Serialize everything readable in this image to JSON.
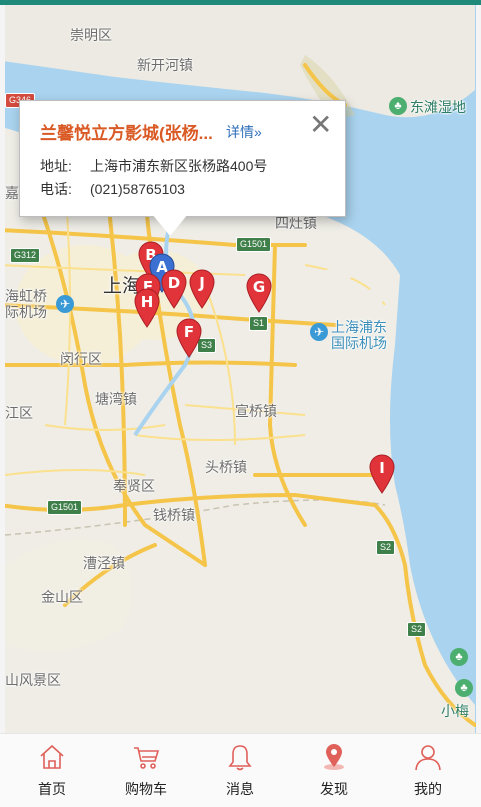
{
  "map": {
    "places": {
      "chongming": "崇明区",
      "xinhe": "新开河镇",
      "dongtan": "东滩湿地",
      "shanghai": "上海",
      "hongqiao": "海虹桥\n际机场",
      "minhang": "闵行区",
      "tangwan": "塘湾镇",
      "xuhui_left": "江区",
      "xuanqiao": "宣桥镇",
      "touqiao": "头桥镇",
      "fengxian": "奉贤区",
      "qianqiao": "钱桥镇",
      "caojing": "漕泾镇",
      "jinshan": "金山区",
      "fengjing": "山风景区",
      "pudong_airport": "上海浦东国际机场",
      "xiaomei": "小梅",
      "ding": "嘉定",
      "sixu": "四灶镇"
    },
    "road_signs": [
      "G1501",
      "G312",
      "G346",
      "G1501",
      "S1",
      "S3",
      "S2",
      "S2"
    ],
    "markers": [
      "A",
      "B",
      "D",
      "E",
      "F",
      "G",
      "H",
      "I",
      "J"
    ],
    "marker_color": "#e0343a",
    "marker_active_color": "#3b6fd1"
  },
  "popup": {
    "title": "兰馨悦立方影城(张杨...",
    "detail_link": "详情»",
    "close_icon": "close-icon",
    "address_label": "地址:",
    "address_value": "上海市浦东新区张杨路400号",
    "phone_label": "电话:",
    "phone_value": "(021)58765103"
  },
  "tabbar": {
    "items": [
      {
        "label": "首页",
        "icon": "home-icon"
      },
      {
        "label": "购物车",
        "icon": "cart-icon"
      },
      {
        "label": "消息",
        "icon": "bell-icon"
      },
      {
        "label": "发现",
        "icon": "discover-pin-icon"
      },
      {
        "label": "我的",
        "icon": "user-icon"
      }
    ],
    "icon_color": "#e0605a"
  }
}
